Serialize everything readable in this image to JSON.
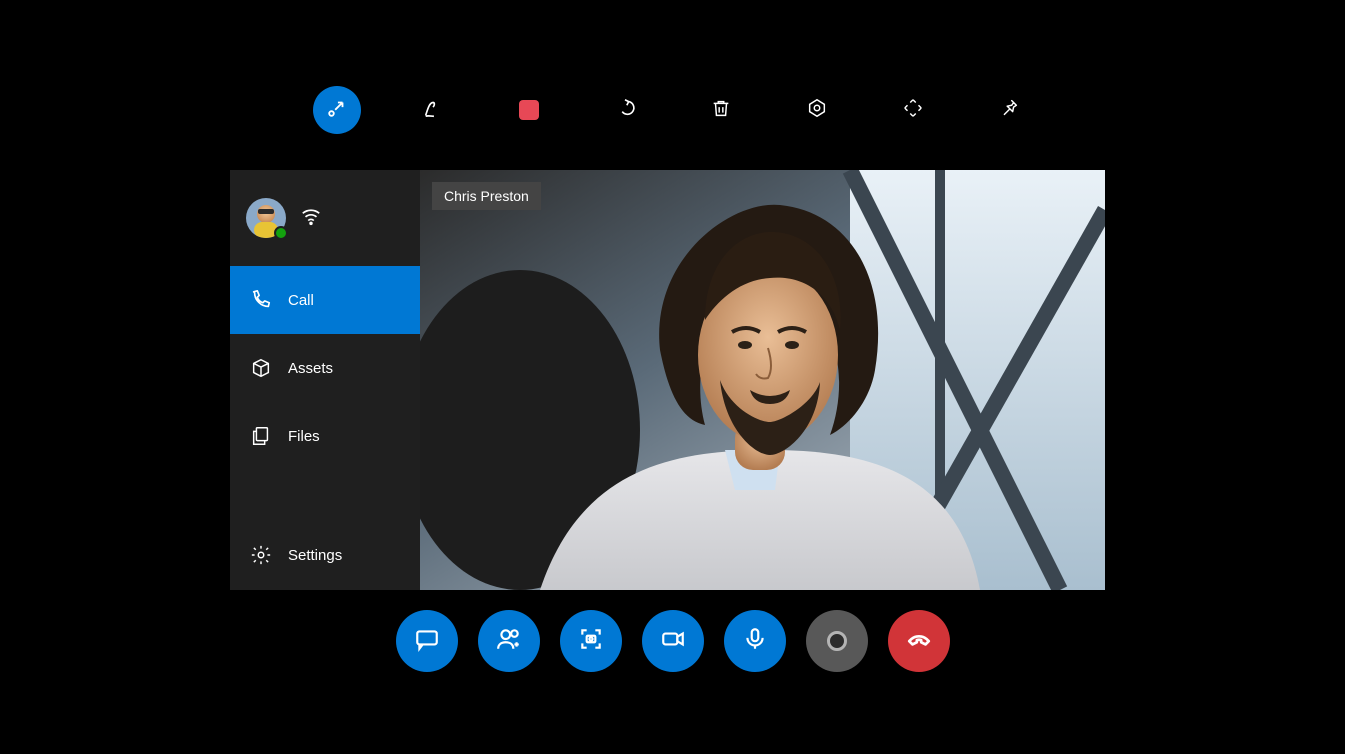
{
  "colors": {
    "accent": "#0078D4",
    "danger": "#D13438",
    "record": "#E74856",
    "presence_available": "#13A10E"
  },
  "top_toolbar": {
    "items": [
      {
        "name": "minimize-diagonal-icon",
        "active": true
      },
      {
        "name": "ink-pen-icon",
        "active": false
      },
      {
        "name": "record-indicator-icon",
        "active": false
      },
      {
        "name": "undo-icon",
        "active": false
      },
      {
        "name": "trash-icon",
        "active": false
      },
      {
        "name": "aperture-icon",
        "active": false
      },
      {
        "name": "expand-arrows-icon",
        "active": false
      },
      {
        "name": "pin-icon",
        "active": false
      }
    ]
  },
  "sidebar": {
    "user_status": "available",
    "nav": [
      {
        "icon": "phone-icon",
        "label": "Call",
        "active": true
      },
      {
        "icon": "package-icon",
        "label": "Assets",
        "active": false
      },
      {
        "icon": "files-icon",
        "label": "Files",
        "active": false
      }
    ],
    "footer": {
      "icon": "gear-icon",
      "label": "Settings"
    }
  },
  "video": {
    "participant_name": "Chris Preston"
  },
  "call_controls": {
    "items": [
      {
        "name": "chat-button",
        "icon": "chat-icon",
        "style": "blue"
      },
      {
        "name": "add-person-button",
        "icon": "add-person-icon",
        "style": "blue"
      },
      {
        "name": "screenshot-button",
        "icon": "camera-frame-icon",
        "style": "blue"
      },
      {
        "name": "video-button",
        "icon": "video-icon",
        "style": "blue"
      },
      {
        "name": "microphone-button",
        "icon": "microphone-icon",
        "style": "blue"
      },
      {
        "name": "record-button",
        "icon": "record-icon",
        "style": "gray"
      },
      {
        "name": "hang-up-button",
        "icon": "hang-up-icon",
        "style": "red"
      }
    ]
  }
}
